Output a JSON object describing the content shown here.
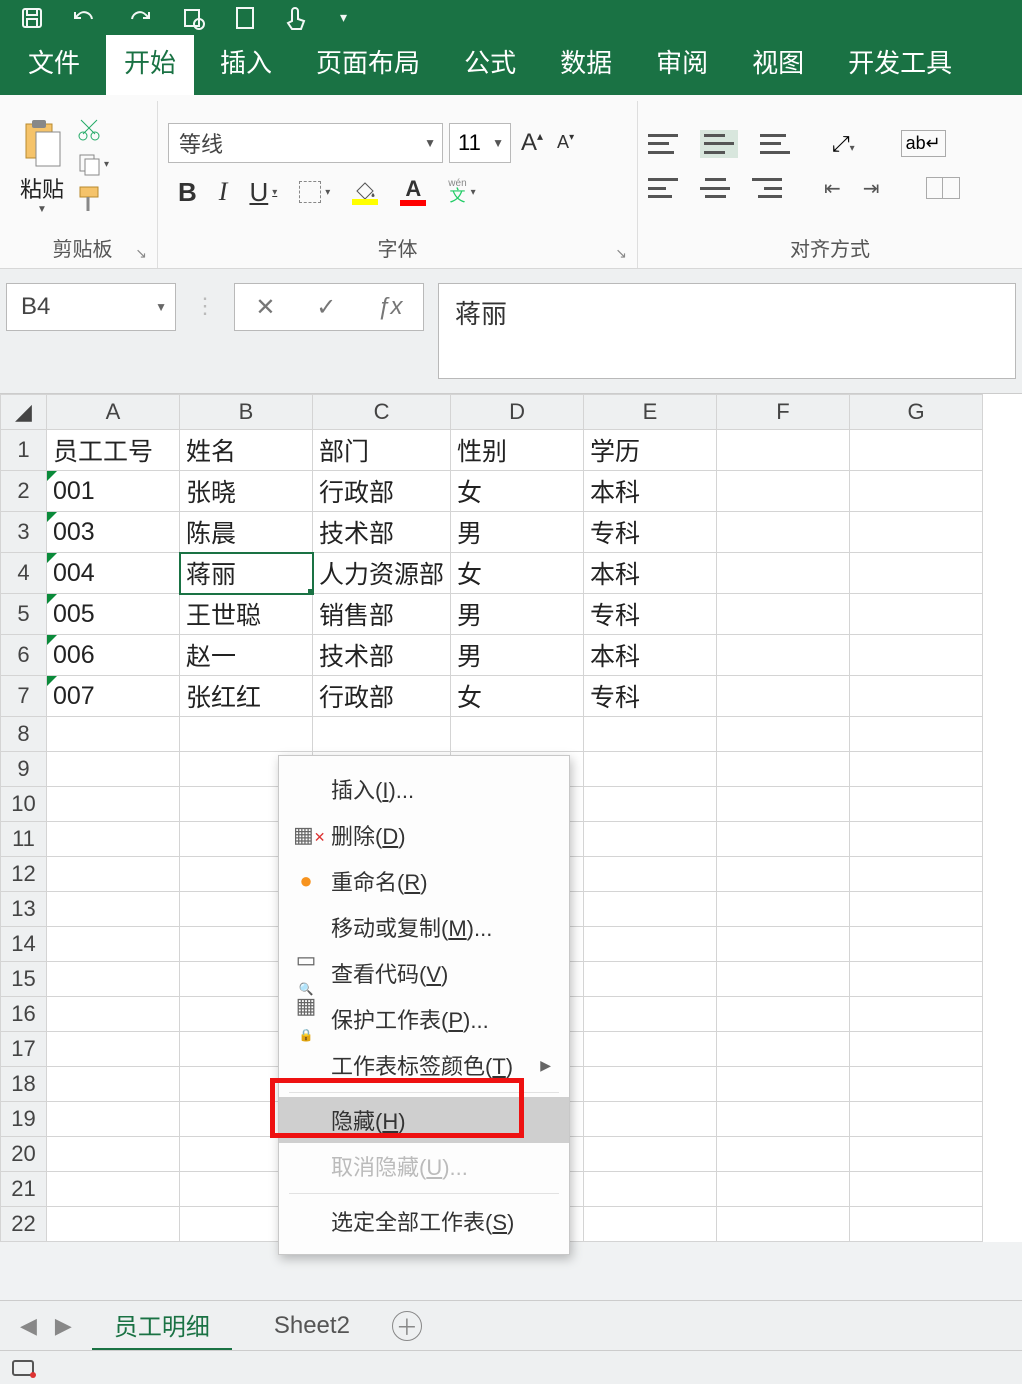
{
  "titlebar": {
    "icons": [
      "save",
      "undo",
      "redo",
      "print-preview",
      "new",
      "touch-mode"
    ]
  },
  "ribbon_tabs": [
    "文件",
    "开始",
    "插入",
    "页面布局",
    "公式",
    "数据",
    "审阅",
    "视图",
    "开发工具"
  ],
  "active_tab_index": 1,
  "ribbon": {
    "clipboard": {
      "paste_label": "粘贴",
      "group_label": "剪贴板"
    },
    "font": {
      "group_label": "字体",
      "name": "等线",
      "size": "11",
      "biu": {
        "b": "B",
        "i": "I",
        "u": "U"
      },
      "phonetic_top": "wén",
      "phonetic_bottom": "文"
    },
    "align": {
      "group_label": "对齐方式",
      "wrap_label": "ab"
    }
  },
  "formula_bar": {
    "cell_ref": "B4",
    "value": "蒋丽",
    "cancel": "✕",
    "enter": "✓",
    "fx": "ƒx"
  },
  "grid": {
    "col_headers": [
      "A",
      "B",
      "C",
      "D",
      "E",
      "F",
      "G"
    ],
    "row_headers": [
      1,
      2,
      3,
      4,
      5,
      6,
      7,
      8,
      9,
      10,
      11,
      12,
      13,
      14,
      15,
      16,
      17,
      18,
      19,
      20,
      21,
      22
    ],
    "selected_col_index": 1,
    "selected_row_index": 3,
    "rows": [
      [
        "员工工号",
        "姓名",
        "部门",
        "性别",
        "学历",
        "",
        ""
      ],
      [
        "001",
        "张晓",
        "行政部",
        "女",
        "本科",
        "",
        ""
      ],
      [
        "003",
        "陈晨",
        "技术部",
        "男",
        "专科",
        "",
        ""
      ],
      [
        "004",
        "蒋丽",
        "人力资源部",
        "女",
        "本科",
        "",
        ""
      ],
      [
        "005",
        "王世聪",
        "销售部",
        "男",
        "专科",
        "",
        ""
      ],
      [
        "006",
        "赵一",
        "技术部",
        "男",
        "本科",
        "",
        ""
      ],
      [
        "007",
        "张红红",
        "行政部",
        "女",
        "专科",
        "",
        ""
      ]
    ]
  },
  "sheet_tabs": {
    "tabs": [
      "员工明细",
      "Sheet2"
    ],
    "active_index": 0
  },
  "context_menu": {
    "insert": "插入(I)...",
    "delete": "删除(D)",
    "rename": "重命名(R)",
    "move": "移动或复制(M)...",
    "viewcode": "查看代码(V)",
    "protect": "保护工作表(P)...",
    "tabcolor": "工作表标签颜色(T)",
    "hide": "隐藏(H)",
    "unhide": "取消隐藏(U)...",
    "selectall": "选定全部工作表(S)"
  }
}
